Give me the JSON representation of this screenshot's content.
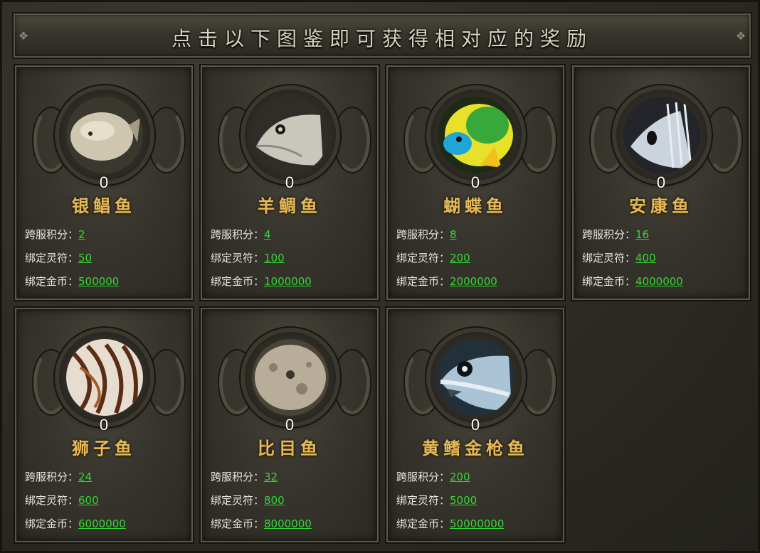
{
  "header": {
    "title": "点击以下图鉴即可获得相对应的奖励"
  },
  "labels": {
    "points": "跨服积分：",
    "talisman": "绑定灵符：",
    "gold": "绑定金币："
  },
  "cards": [
    {
      "name": "银鲳鱼",
      "count": "0",
      "points": "2",
      "talisman": "50",
      "gold": "500000",
      "icon": "silver-pomfret-icon",
      "color": "#cfc6b0"
    },
    {
      "name": "羊鲷鱼",
      "count": "0",
      "points": "4",
      "talisman": "100",
      "gold": "1000000",
      "icon": "sheepshead-icon",
      "color": "#c9c6bc"
    },
    {
      "name": "蝴蝶鱼",
      "count": "0",
      "points": "8",
      "talisman": "200",
      "gold": "2000000",
      "icon": "butterflyfish-icon",
      "color": "#6fcf3a"
    },
    {
      "name": "安康鱼",
      "count": "0",
      "points": "16",
      "talisman": "400",
      "gold": "4000000",
      "icon": "anglerfish-icon",
      "color": "#cbd3dd"
    },
    {
      "name": "狮子鱼",
      "count": "0",
      "points": "24",
      "talisman": "600",
      "gold": "6000000",
      "icon": "lionfish-icon",
      "color": "#b9823c"
    },
    {
      "name": "比目鱼",
      "count": "0",
      "points": "32",
      "talisman": "800",
      "gold": "8000000",
      "icon": "flounder-icon",
      "color": "#b8ad98"
    },
    {
      "name": "黄鳍金枪鱼",
      "count": "0",
      "points": "200",
      "talisman": "5000",
      "gold": "50000000",
      "icon": "yellowfin-tuna-icon",
      "color": "#aac4d6"
    }
  ]
}
